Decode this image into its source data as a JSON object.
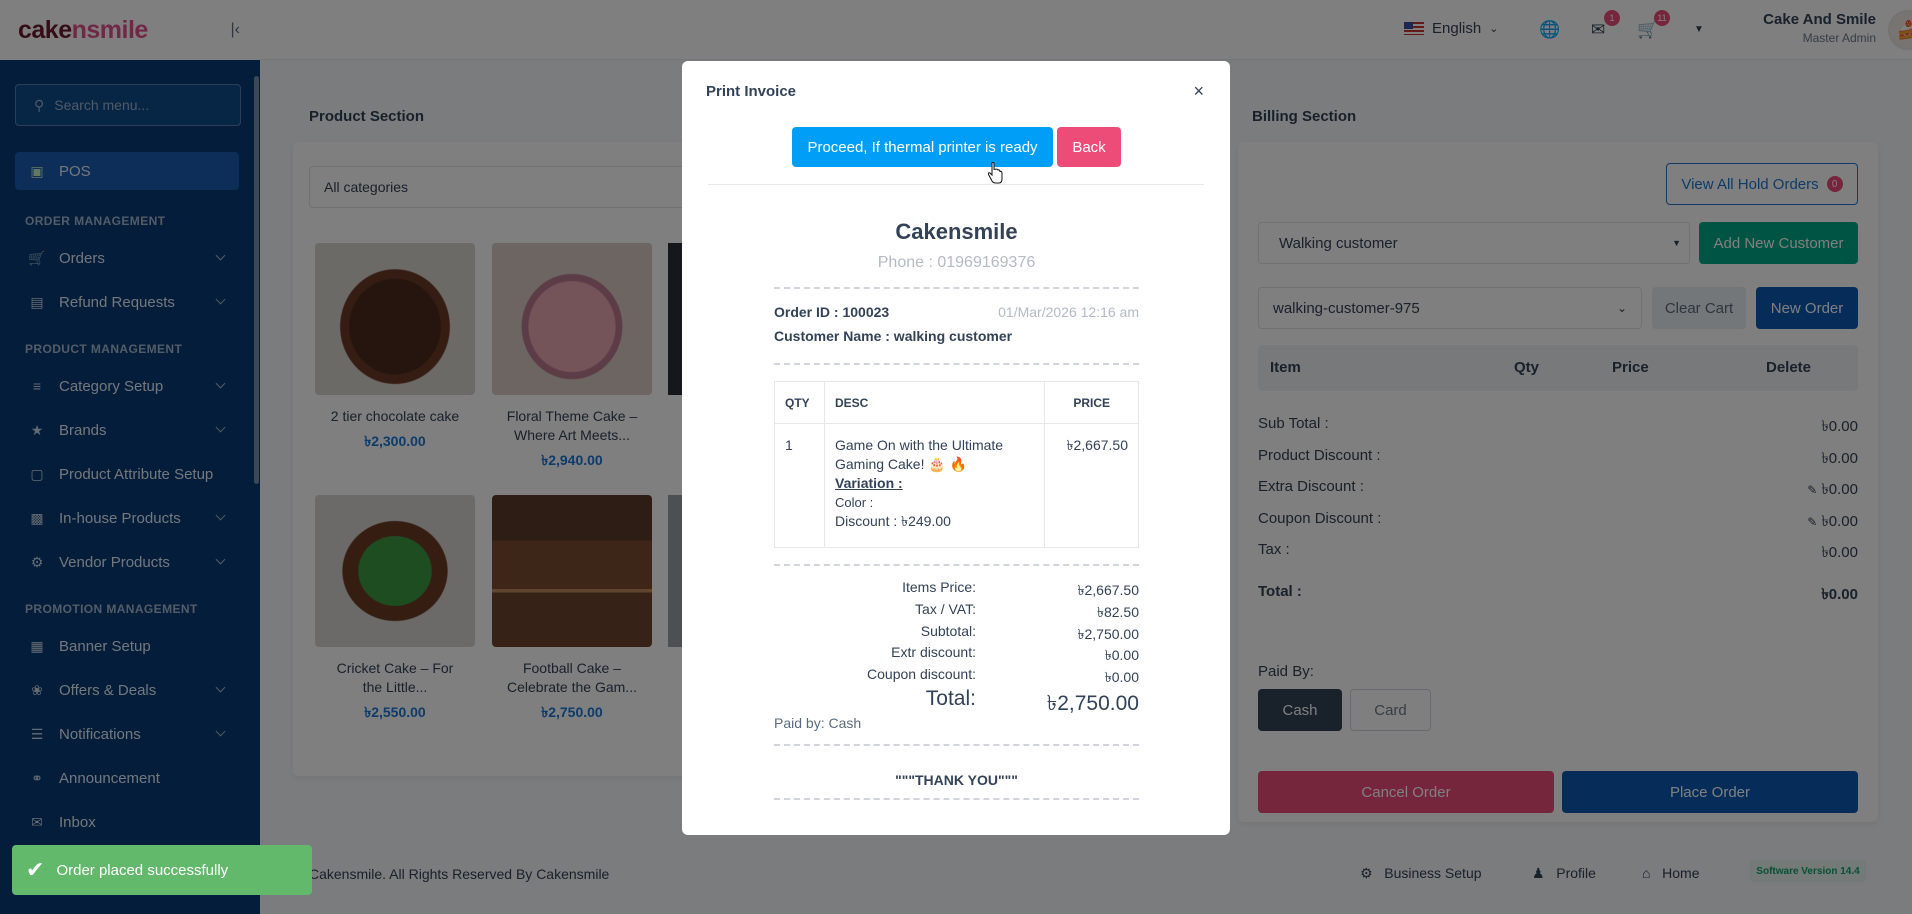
{
  "sidebar": {
    "logo_a": "cake",
    "logo_b": "nsmile",
    "search_placeholder": "Search menu...",
    "pos_label": "POS",
    "heads": {
      "order": "ORDER MANAGEMENT",
      "product": "PRODUCT MANAGEMENT",
      "promotion": "PROMOTION MANAGEMENT"
    },
    "items": {
      "orders": "Orders",
      "refund": "Refund Requests",
      "category": "Category Setup",
      "brands": "Brands",
      "attribute": "Product Attribute Setup",
      "inhouse": "In-house Products",
      "vendor": "Vendor Products",
      "banner": "Banner Setup",
      "offers": "Offers & Deals",
      "notifications": "Notifications",
      "announcement": "Announcement",
      "inbox": "Inbox"
    }
  },
  "topbar": {
    "language": "English",
    "messages_badge": "1",
    "cart_badge": "11",
    "user_name": "Cake And Smile",
    "user_role": "Master Admin"
  },
  "product_section": {
    "title": "Product Section",
    "category_select": "All categories",
    "products": [
      {
        "name_l1": "2 tier chocolate cake",
        "name_l2": "",
        "price": "৳2,300.00"
      },
      {
        "name_l1": "Floral Theme Cake –",
        "name_l2": "Where Art Meets...",
        "price": "৳2,940.00"
      },
      {
        "name_l1": "Cricket Cake – For",
        "name_l2": "the Little...",
        "price": "৳2,550.00"
      },
      {
        "name_l1": "Football Cake –",
        "name_l2": "Celebrate the Gam...",
        "price": "৳2,750.00"
      }
    ]
  },
  "billing": {
    "title": "Billing Section",
    "hold_orders_label": "View All Hold Orders",
    "hold_count": "0",
    "customer_select": "Walking customer",
    "add_customer": "Add New Customer",
    "cart_select": "walking-customer-975",
    "clear_cart": "Clear Cart",
    "new_order": "New Order",
    "columns": [
      "Item",
      "Qty",
      "Price",
      "Delete"
    ],
    "sub_total_label": "Sub Total :",
    "sub_total": "৳0.00",
    "product_discount_label": "Product Discount :",
    "product_discount": "৳0.00",
    "extra_discount_label": "Extra Discount :",
    "extra_discount": "৳0.00",
    "coupon_discount_label": "Coupon Discount :",
    "coupon_discount": "৳0.00",
    "tax_label": "Tax :",
    "tax": "৳0.00",
    "total_label": "Total :",
    "total": "৳0.00",
    "paid_by_label": "Paid By:",
    "cash": "Cash",
    "card": "Card",
    "cancel_order": "Cancel Order",
    "place_order": "Place Order"
  },
  "modal": {
    "title": "Print Invoice",
    "close": "×",
    "proceed": "Proceed, If thermal printer is ready",
    "back": "Back",
    "shop_name": "Cakensmile",
    "phone": "Phone : 01969169376",
    "order_id": "Order ID : 100023",
    "date": "01/Mar/2026 12:16 am",
    "customer": "Customer Name : walking customer",
    "table_headers": [
      "QTY",
      "DESC",
      "PRICE"
    ],
    "item": {
      "qty": "1",
      "desc_l1": "Game On with the Ultimate",
      "desc_l2": "Gaming Cake! 🎂 🔥",
      "variation": "Variation :",
      "color": "Color :",
      "discount": "Discount : ৳249.00",
      "price": "৳2,667.50"
    },
    "totals": [
      {
        "label": "Items Price:",
        "value": "৳2,667.50"
      },
      {
        "label": "Tax / VAT:",
        "value": "৳82.50"
      },
      {
        "label": "Subtotal:",
        "value": "৳2,750.00"
      },
      {
        "label": "Extr discount:",
        "value": "৳0.00"
      },
      {
        "label": "Coupon discount:",
        "value": "৳0.00"
      }
    ],
    "grand_total_label": "Total:",
    "grand_total": "৳2,750.00",
    "paid_by": "Paid by: Cash",
    "thank_you": "\"\"\"THANK YOU\"\"\""
  },
  "footer": {
    "copyright": "Cakensmile. All Rights Reserved By Cakensmile",
    "business_setup": "Business Setup",
    "profile": "Profile",
    "home": "Home",
    "version": "Software Version 14.4"
  },
  "toast": "Order placed successfully"
}
